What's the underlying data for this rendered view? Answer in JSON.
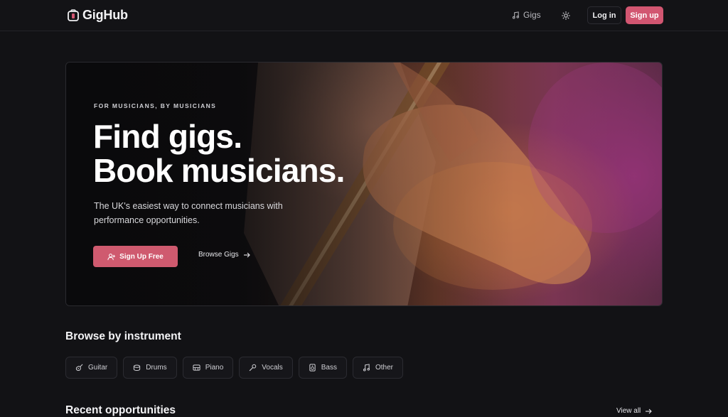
{
  "app": {
    "name": "GigHub",
    "logo_icon": "guitar-amp-icon"
  },
  "nav": {
    "gigs_label": "Gigs",
    "gigs_icon": "music-note-icon",
    "theme_icon": "sun-icon",
    "login_label": "Log in",
    "signup_label": "Sign up"
  },
  "hero": {
    "eyebrow": "FOR MUSICIANS, BY MUSICIANS",
    "headline_line1": "Find gigs.",
    "headline_line2": "Book musicians.",
    "subtext": "The UK's easiest way to connect musicians with performance opportunities.",
    "primary_cta": "Sign Up Free",
    "primary_cta_icon": "user-plus-icon",
    "secondary_cta": "Browse Gigs",
    "secondary_cta_icon": "arrow-right-icon"
  },
  "instruments": {
    "title": "Browse by instrument",
    "items": [
      {
        "label": "Guitar",
        "icon": "guitar-icon"
      },
      {
        "label": "Drums",
        "icon": "drum-icon"
      },
      {
        "label": "Piano",
        "icon": "piano-icon"
      },
      {
        "label": "Vocals",
        "icon": "microphone-icon"
      },
      {
        "label": "Bass",
        "icon": "speaker-icon"
      },
      {
        "label": "Other",
        "icon": "music-note-icon"
      }
    ]
  },
  "recent": {
    "title": "Recent opportunities",
    "view_all": "View all"
  },
  "colors": {
    "accent": "#d25671",
    "background": "#121215",
    "border": "#2b2b31"
  }
}
